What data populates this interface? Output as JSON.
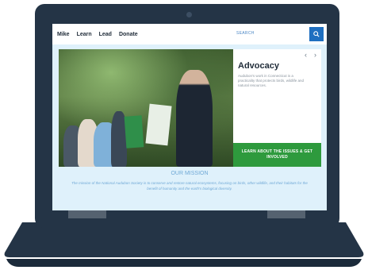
{
  "nav": {
    "items": [
      "Mike",
      "Learn",
      "Lead",
      "Donate"
    ],
    "search_label": "SEARCH",
    "search_icon": "search-icon"
  },
  "hero": {
    "prev_arrow": "‹",
    "next_arrow": "›",
    "panel_title": "Advocacy",
    "panel_description": "Audubon's work in Connecticut is a practicality that protects birds, wildlife and natural resources.",
    "cta_label": "LEARN ABOUT THE ISSUES & GET INVOLVED"
  },
  "mission": {
    "heading": "OUR MISSION",
    "text": "The mission of the National Audubon Society is to conserve and restore natural ecosystems, focusing on birds, other wildlife, and their habitats for the benefit of humanity and the earth's biological diversity."
  },
  "colors": {
    "laptop_body": "#243446",
    "nav_accent": "#1f6fc0",
    "cta_green": "#2e9a3d",
    "screen_bg": "#dff1fb"
  }
}
